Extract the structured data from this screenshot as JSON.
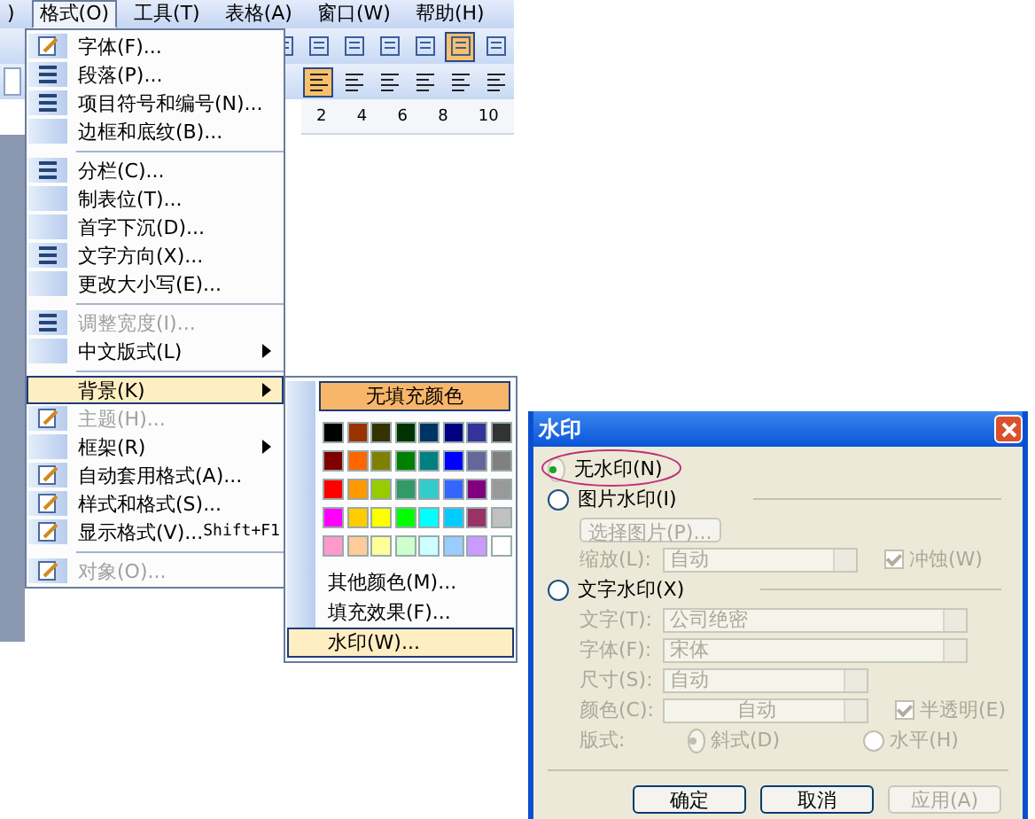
{
  "menubar": [
    {
      "label": ")",
      "selected": false
    },
    {
      "label": "格式(O)",
      "selected": true
    },
    {
      "label": "工具(T)",
      "selected": false
    },
    {
      "label": "表格(A)",
      "selected": false
    },
    {
      "label": "窗口(W)",
      "selected": false
    },
    {
      "label": "帮助(H)",
      "selected": false
    }
  ],
  "toolbars": [
    [
      {
        "pressed": false
      },
      {
        "pressed": false
      },
      {
        "pressed": false
      },
      {
        "pressed": false
      },
      {
        "pressed": false
      },
      {
        "pressed": true
      },
      {
        "pressed": false
      }
    ],
    [
      {
        "pressed": true
      },
      {
        "pressed": false
      },
      {
        "pressed": false
      },
      {
        "pressed": false
      },
      {
        "pressed": false
      },
      {
        "pressed": false
      }
    ]
  ],
  "ruler": {
    "marks": [
      "2",
      "4",
      "6",
      "8",
      "10"
    ]
  },
  "format_menu": {
    "items": [
      {
        "kind": "item",
        "label": "字体(F)...",
        "disabled": false,
        "highlighted": false,
        "submenu": false
      },
      {
        "kind": "item",
        "label": "段落(P)...",
        "disabled": false,
        "highlighted": false,
        "submenu": false
      },
      {
        "kind": "item",
        "label": "项目符号和编号(N)...",
        "disabled": false,
        "highlighted": false,
        "submenu": false
      },
      {
        "kind": "item",
        "label": "边框和底纹(B)...",
        "disabled": false,
        "highlighted": false,
        "submenu": false
      },
      {
        "kind": "separator"
      },
      {
        "kind": "item",
        "label": "分栏(C)...",
        "disabled": false,
        "highlighted": false,
        "submenu": false
      },
      {
        "kind": "item",
        "label": "制表位(T)...",
        "disabled": false,
        "highlighted": false,
        "submenu": false
      },
      {
        "kind": "item",
        "label": "首字下沉(D)...",
        "disabled": false,
        "highlighted": false,
        "submenu": false
      },
      {
        "kind": "item",
        "label": "文字方向(X)...",
        "disabled": false,
        "highlighted": false,
        "submenu": false
      },
      {
        "kind": "item",
        "label": "更改大小写(E)...",
        "disabled": false,
        "highlighted": false,
        "submenu": false
      },
      {
        "kind": "separator"
      },
      {
        "kind": "item",
        "label": "调整宽度(I)...",
        "disabled": true,
        "highlighted": false,
        "submenu": false
      },
      {
        "kind": "item",
        "label": "中文版式(L)",
        "disabled": false,
        "highlighted": false,
        "submenu": true
      },
      {
        "kind": "separator"
      },
      {
        "kind": "item",
        "label": "背景(K)",
        "disabled": false,
        "highlighted": true,
        "submenu": true
      },
      {
        "kind": "item",
        "label": "主题(H)...",
        "disabled": true,
        "highlighted": false,
        "submenu": false
      },
      {
        "kind": "item",
        "label": "框架(R)",
        "disabled": false,
        "highlighted": false,
        "submenu": true
      },
      {
        "kind": "item",
        "label": "自动套用格式(A)...",
        "disabled": false,
        "highlighted": false,
        "submenu": false
      },
      {
        "kind": "item",
        "label": "样式和格式(S)...",
        "disabled": false,
        "highlighted": false,
        "submenu": false
      },
      {
        "kind": "item",
        "label": "显示格式(V)...",
        "shortcut": "Shift+F1",
        "disabled": false,
        "highlighted": false,
        "submenu": false
      },
      {
        "kind": "separator"
      },
      {
        "kind": "item",
        "label": "对象(O)...",
        "disabled": true,
        "highlighted": false,
        "submenu": false
      }
    ]
  },
  "background_submenu": {
    "no_fill": "无填充颜色",
    "swatches": [
      {
        "color": "#000000"
      },
      {
        "color": "#993300"
      },
      {
        "color": "#333300"
      },
      {
        "color": "#003300"
      },
      {
        "color": "#003366"
      },
      {
        "color": "#000080"
      },
      {
        "color": "#333399"
      },
      {
        "color": "#333333"
      },
      {
        "color": "#800000"
      },
      {
        "color": "#ff6600"
      },
      {
        "color": "#808000"
      },
      {
        "color": "#008000"
      },
      {
        "color": "#008080"
      },
      {
        "color": "#0000ff"
      },
      {
        "color": "#666699"
      },
      {
        "color": "#808080"
      },
      {
        "color": "#ff0000"
      },
      {
        "color": "#ff9900"
      },
      {
        "color": "#99cc00"
      },
      {
        "color": "#339966"
      },
      {
        "color": "#33cccc"
      },
      {
        "color": "#3366ff"
      },
      {
        "color": "#800080"
      },
      {
        "color": "#999999"
      },
      {
        "color": "#ff00ff"
      },
      {
        "color": "#ffcc00"
      },
      {
        "color": "#ffff00"
      },
      {
        "color": "#00ff00"
      },
      {
        "color": "#00ffff"
      },
      {
        "color": "#00ccff"
      },
      {
        "color": "#993366"
      },
      {
        "color": "#c0c0c0"
      },
      {
        "color": "#ff99cc"
      },
      {
        "color": "#ffcc99"
      },
      {
        "color": "#ffff99"
      },
      {
        "color": "#ccffcc"
      },
      {
        "color": "#ccffff"
      },
      {
        "color": "#99ccff"
      },
      {
        "color": "#cc99ff"
      },
      {
        "color": "#ffffff"
      }
    ],
    "items": [
      {
        "label": "其他颜色(M)...",
        "highlighted": false
      },
      {
        "label": "填充效果(F)...",
        "highlighted": false
      },
      {
        "label": "水印(W)...",
        "highlighted": true
      }
    ]
  },
  "dialog": {
    "title": "水印",
    "no_watermark": {
      "label": "无水印(N)",
      "selected": true,
      "annotated": true
    },
    "picture_watermark": {
      "label": "图片水印(I)",
      "selected": false,
      "disabled": true,
      "select_button": "选择图片(P)...",
      "scale_label": "缩放(L):",
      "scale_value": "自动",
      "washout": {
        "label": "冲蚀(W)",
        "checked": true
      }
    },
    "text_watermark": {
      "label": "文字水印(X)",
      "selected": false,
      "disabled": true,
      "fields": [
        {
          "kind": "wide",
          "label": "文字(T):",
          "value": "公司绝密"
        },
        {
          "kind": "wide",
          "label": "字体(F):",
          "value": "宋体"
        },
        {
          "kind": "short",
          "label": "尺寸(S):",
          "value": "自动"
        },
        {
          "kind": "color",
          "label": "颜色(C):",
          "value": "自动"
        }
      ],
      "semitransparent": {
        "label": "半透明(E)",
        "checked": true
      },
      "layout_label": "版式:",
      "layout_options": [
        {
          "label": "斜式(D)",
          "selected": true
        },
        {
          "label": "水平(H)",
          "selected": false
        }
      ]
    },
    "buttons": [
      {
        "label": "确定",
        "disabled": false
      },
      {
        "label": "取消",
        "disabled": false
      },
      {
        "label": "应用(A)",
        "disabled": true
      }
    ]
  }
}
